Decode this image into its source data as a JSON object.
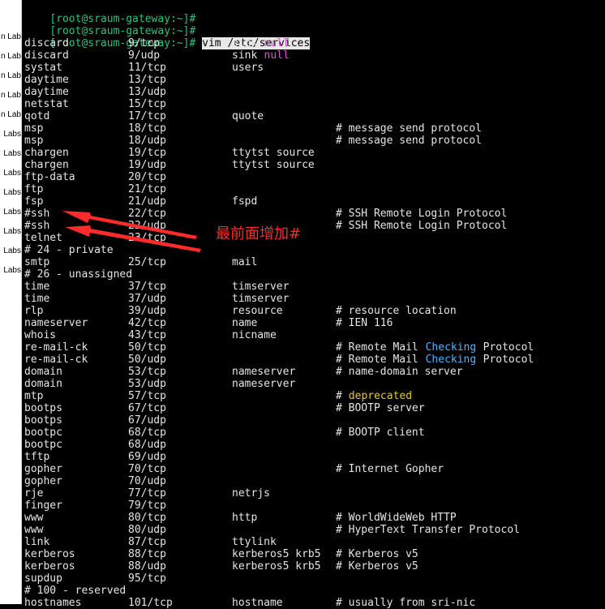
{
  "sidebar": {
    "items": [
      "n Lab",
      "n Lab",
      "n Lab",
      "n Lab",
      "n Lab",
      "Labs",
      "Labs",
      "Labs",
      "Labs",
      "Labs",
      "Labs",
      "Labs",
      "Labs"
    ]
  },
  "prompt": "[root@sraum-gateway:~]#",
  "command": "vim /etc/services",
  "colors": {
    "prompt": "#2ec27e",
    "null": "#e04de0",
    "checking": "#4fb3ff",
    "deprecated": "#e6d000",
    "annotation": "#ff2b2b"
  },
  "rows": [
    {
      "n": "discard",
      "p": "9/tcp",
      "a": "sink",
      "a2": "null",
      "c": ""
    },
    {
      "n": "discard",
      "p": "9/udp",
      "a": "sink",
      "a2": "null",
      "c": ""
    },
    {
      "n": "systat",
      "p": "11/tcp",
      "a": "users",
      "c": ""
    },
    {
      "n": "daytime",
      "p": "13/tcp",
      "a": "",
      "c": ""
    },
    {
      "n": "daytime",
      "p": "13/udp",
      "a": "",
      "c": ""
    },
    {
      "n": "netstat",
      "p": "15/tcp",
      "a": "",
      "c": ""
    },
    {
      "n": "qotd",
      "p": "17/tcp",
      "a": "quote",
      "c": ""
    },
    {
      "n": "msp",
      "p": "18/tcp",
      "a": "",
      "c": "# message send protocol"
    },
    {
      "n": "msp",
      "p": "18/udp",
      "a": "",
      "c": "# message send protocol"
    },
    {
      "n": "chargen",
      "p": "19/tcp",
      "a": "ttytst source",
      "c": ""
    },
    {
      "n": "chargen",
      "p": "19/udp",
      "a": "ttytst source",
      "c": ""
    },
    {
      "n": "ftp-data",
      "p": "20/tcp",
      "a": "",
      "c": ""
    },
    {
      "n": "ftp",
      "p": "21/tcp",
      "a": "",
      "c": ""
    },
    {
      "n": "fsp",
      "p": "21/udp",
      "a": "fspd",
      "c": ""
    },
    {
      "n": "#ssh",
      "p": "22/tcp",
      "a": "",
      "c": "# SSH Remote Login Protocol"
    },
    {
      "n": "#ssh",
      "p": "22/udp",
      "a": "",
      "c": "# SSH Remote Login Protocol"
    },
    {
      "n": "telnet",
      "p": "23/tcp",
      "a": "",
      "c": ""
    },
    {
      "raw": "# 24 - private"
    },
    {
      "n": "smtp",
      "p": "25/tcp",
      "a": "mail",
      "c": ""
    },
    {
      "raw": "# 26 - unassigned"
    },
    {
      "n": "time",
      "p": "37/tcp",
      "a": "timserver",
      "c": ""
    },
    {
      "n": "time",
      "p": "37/udp",
      "a": "timserver",
      "c": ""
    },
    {
      "n": "rlp",
      "p": "39/udp",
      "a": "resource",
      "c": "# resource location"
    },
    {
      "n": "nameserver",
      "p": "42/tcp",
      "a": "name",
      "c": "# IEN 116"
    },
    {
      "n": "whois",
      "p": "43/tcp",
      "a": "nicname",
      "c": ""
    },
    {
      "n": "re-mail-ck",
      "p": "50/tcp",
      "a": "",
      "c": "# Remote Mail ",
      "cc": "Checking",
      "c2": " Protocol"
    },
    {
      "n": "re-mail-ck",
      "p": "50/udp",
      "a": "",
      "c": "# Remote Mail ",
      "cc": "Checking",
      "c2": " Protocol"
    },
    {
      "n": "domain",
      "p": "53/tcp",
      "a": "nameserver",
      "c": "# name-domain server"
    },
    {
      "n": "domain",
      "p": "53/udp",
      "a": "nameserver",
      "c": ""
    },
    {
      "n": "mtp",
      "p": "57/tcp",
      "a": "",
      "c": "# ",
      "cy": "deprecated"
    },
    {
      "n": "bootps",
      "p": "67/tcp",
      "a": "",
      "c": "# BOOTP server"
    },
    {
      "n": "bootps",
      "p": "67/udp",
      "a": "",
      "c": ""
    },
    {
      "n": "bootpc",
      "p": "68/tcp",
      "a": "",
      "c": "# BOOTP client"
    },
    {
      "n": "bootpc",
      "p": "68/udp",
      "a": "",
      "c": ""
    },
    {
      "n": "tftp",
      "p": "69/udp",
      "a": "",
      "c": ""
    },
    {
      "n": "gopher",
      "p": "70/tcp",
      "a": "",
      "c": "# Internet Gopher"
    },
    {
      "n": "gopher",
      "p": "70/udp",
      "a": "",
      "c": ""
    },
    {
      "n": "rje",
      "p": "77/tcp",
      "a": "netrjs",
      "c": ""
    },
    {
      "n": "finger",
      "p": "79/tcp",
      "a": "",
      "c": ""
    },
    {
      "n": "www",
      "p": "80/tcp",
      "a": "http",
      "c": "# WorldWideWeb HTTP"
    },
    {
      "n": "www",
      "p": "80/udp",
      "a": "",
      "c": "# HyperText Transfer Protocol"
    },
    {
      "n": "link",
      "p": "87/tcp",
      "a": "ttylink",
      "c": ""
    },
    {
      "n": "kerberos",
      "p": "88/tcp",
      "a": "kerberos5 krb5",
      "c": "# Kerberos v5"
    },
    {
      "n": "kerberos",
      "p": "88/udp",
      "a": "kerberos5 krb5",
      "c": "# Kerberos v5"
    },
    {
      "n": "supdup",
      "p": "95/tcp",
      "a": "",
      "c": ""
    },
    {
      "raw": "# 100 - reserved"
    },
    {
      "n": "hostnames",
      "p": "101/tcp",
      "a": "hostname",
      "c": "# usually from sri-nic"
    }
  ],
  "annotation": "最前面增加#"
}
